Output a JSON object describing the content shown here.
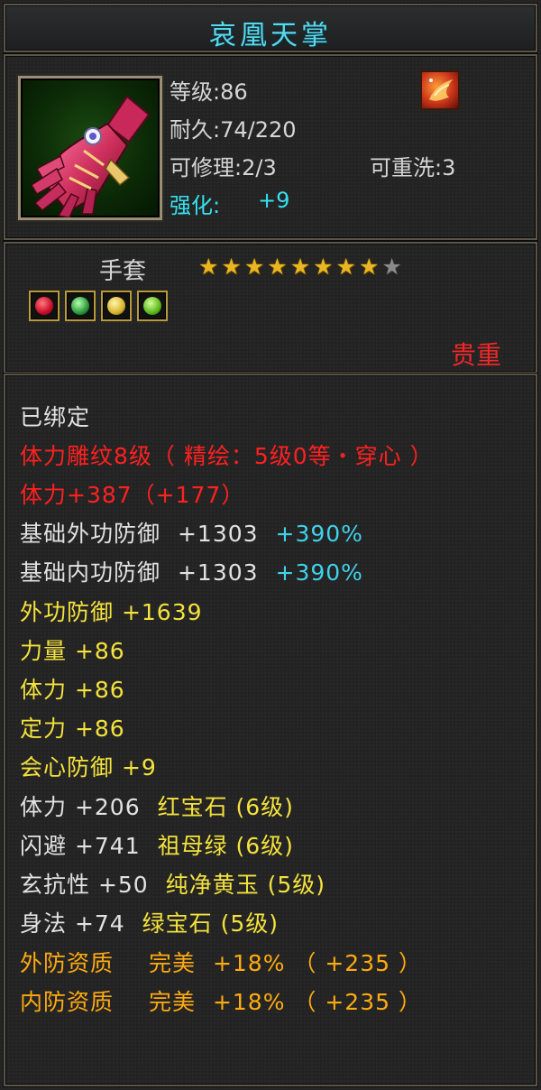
{
  "item": {
    "name": "哀凰天掌",
    "level": "等级:86",
    "durability": "耐久:74/220",
    "repairable": "可修理:2/3",
    "rewash": "可重洗:3",
    "enhance_label": "强化:",
    "enhance_value": "+9",
    "type": "手套",
    "stars_filled": 8,
    "stars_total": 9,
    "rarity": "贵重",
    "gem_icons": [
      "red-gem-icon",
      "green-gem-icon",
      "yellow-gem-icon",
      "emerald-gem-icon"
    ]
  },
  "attributes": {
    "bound": "已绑定",
    "engrave": "体力雕纹8级（ 精绘：5级0等・穿心 ）",
    "vitality_main": "体力+387（+177）",
    "base_ext_def": {
      "label": "基础外功防御",
      "value": "+1303",
      "pct": "+390%"
    },
    "base_int_def": {
      "label": "基础内功防御",
      "value": "+1303",
      "pct": "+390%"
    },
    "ext_def": "外功防御 +1639",
    "strength": "力量 +86",
    "vitality": "体力 +86",
    "stability": "定力 +86",
    "crit_def": "会心防御 +9",
    "gem_lines": [
      {
        "label": "体力 +206",
        "gem": "红宝石 (6级)"
      },
      {
        "label": "闪避 +741",
        "gem": "祖母绿 (6级)"
      },
      {
        "label": "玄抗性 +50",
        "gem": "纯净黄玉 (5级)"
      },
      {
        "label": "身法 +74",
        "gem": "绿宝石 (5级)"
      }
    ],
    "quality": [
      {
        "label": "外防资质",
        "grade": "完美",
        "value": "+18% （ +235 ）"
      },
      {
        "label": "内防资质",
        "grade": "完美",
        "value": "+18% （ +235 ）"
      }
    ]
  },
  "colors": {
    "title": "#59d8ec",
    "red": "#ff2020",
    "yellow": "#f4e23c",
    "orange": "#ffab10",
    "cyan": "#3fd2ea",
    "star": "#e8b623"
  }
}
